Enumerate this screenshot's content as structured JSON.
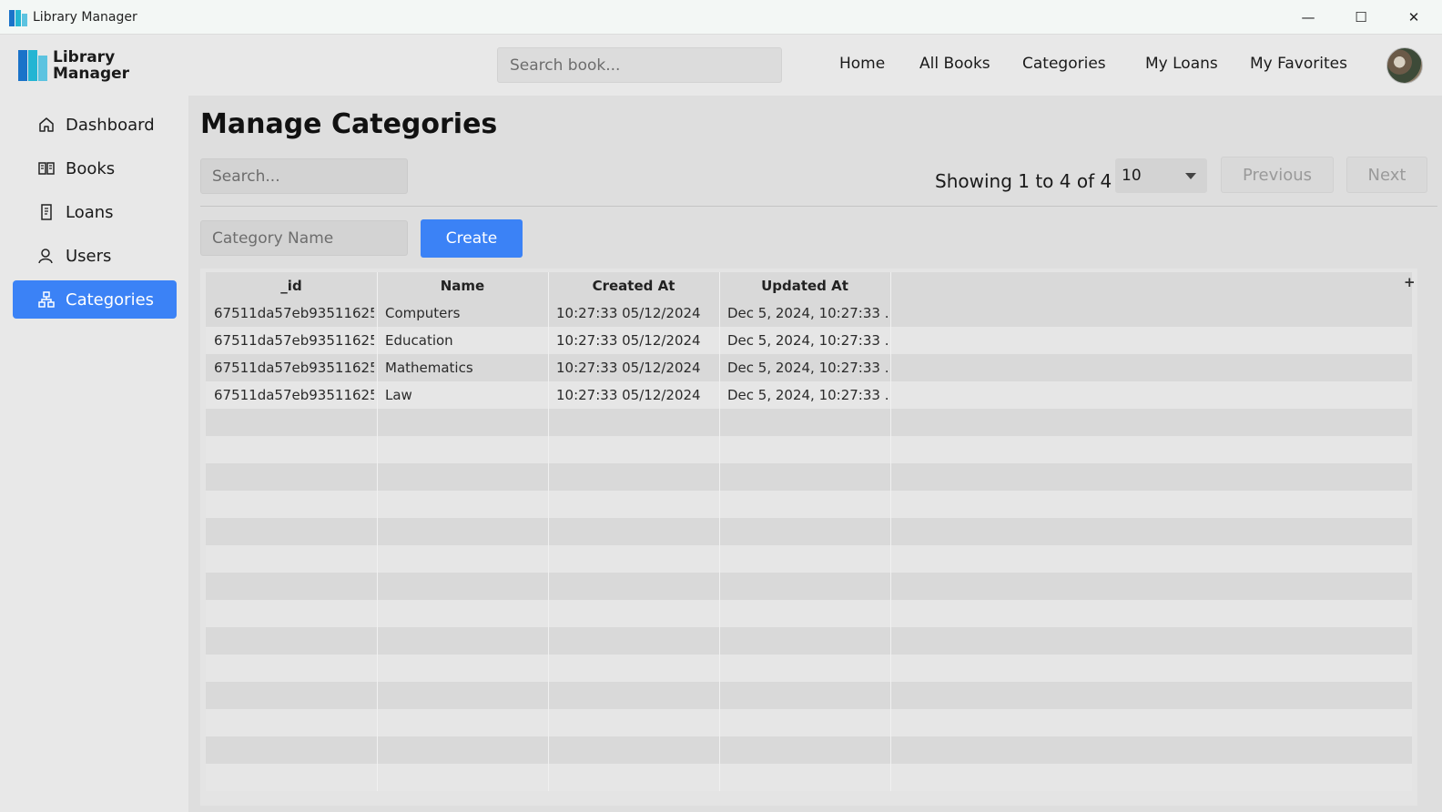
{
  "window": {
    "title": "Library Manager",
    "controls": {
      "minimize": "—",
      "maximize": "☐",
      "close": "✕"
    }
  },
  "header": {
    "logo_line1": "Library",
    "logo_line2": "Manager",
    "search_placeholder": "Search book...",
    "nav": [
      "Home",
      "All Books",
      "Categories",
      "My Loans",
      "My Favorites"
    ]
  },
  "sidebar": {
    "items": [
      {
        "label": "Dashboard",
        "icon": "home-icon",
        "active": false
      },
      {
        "label": "Books",
        "icon": "book-icon",
        "active": false
      },
      {
        "label": "Loans",
        "icon": "receipt-icon",
        "active": false
      },
      {
        "label": "Users",
        "icon": "users-icon",
        "active": false
      },
      {
        "label": "Categories",
        "icon": "hierarchy-icon",
        "active": true
      }
    ]
  },
  "main": {
    "title": "Manage Categories",
    "search_placeholder": "Search...",
    "showing": "Showing 1 to 4 of 4",
    "page_size": "10",
    "previous": "Previous",
    "next": "Next",
    "category_placeholder": "Category Name",
    "create": "Create"
  },
  "table": {
    "columns": [
      "_id",
      "Name",
      "Created At",
      "Updated At"
    ],
    "add_column": "+",
    "rows": [
      [
        "67511da57eb93511625...",
        "Computers",
        "10:27:33 05/12/2024",
        "Dec 5, 2024, 10:27:33 ..."
      ],
      [
        "67511da57eb93511625...",
        "Education",
        "10:27:33 05/12/2024",
        "Dec 5, 2024, 10:27:33 ..."
      ],
      [
        "67511da57eb93511625...",
        "Mathematics",
        "10:27:33 05/12/2024",
        "Dec 5, 2024, 10:27:33 ..."
      ],
      [
        "67511da57eb93511625...",
        "Law",
        "10:27:33 05/12/2024",
        "Dec 5, 2024, 10:27:33 ..."
      ]
    ]
  },
  "colors": {
    "accent": "#3b82f6",
    "logo_blue": "#1a73c9",
    "logo_teal": "#24b5d3"
  }
}
